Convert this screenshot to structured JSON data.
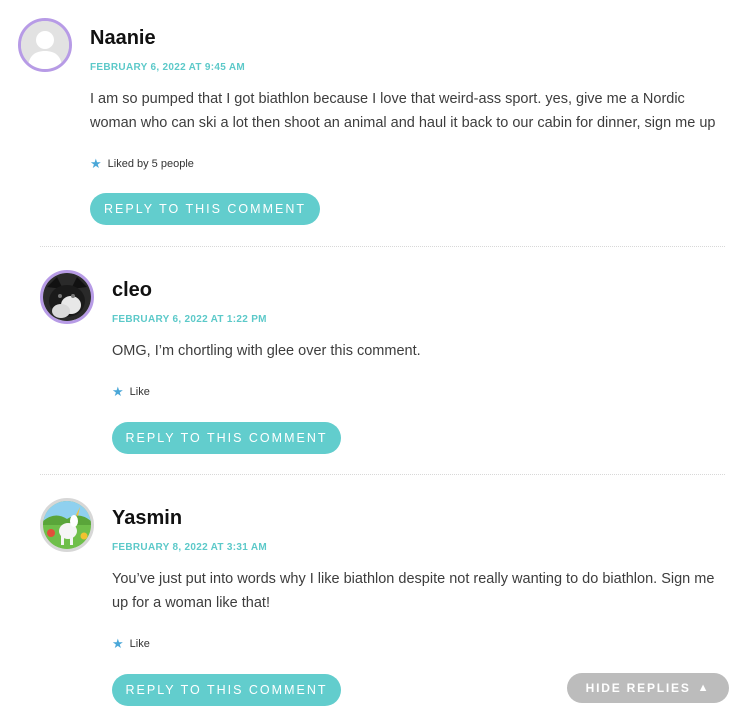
{
  "comments": [
    {
      "author": "Naanie",
      "date": "FEBRUARY 6, 2022 AT 9:45 AM",
      "text": "I am so pumped that I got biathlon because I love that weird-ass sport. yes, give me a Nordic woman who can ski a lot then shoot an animal and haul it back to our cabin for dinner, sign me up",
      "likes": "Liked by 5 people",
      "reply_label": "REPLY TO THIS COMMENT",
      "avatar_icon": "default-person-avatar"
    },
    {
      "author": "cleo",
      "date": "FEBRUARY 6, 2022 AT 1:22 PM",
      "text": "OMG, I’m chortling with glee over this comment.",
      "likes": "Like",
      "reply_label": "REPLY TO THIS COMMENT",
      "avatar_icon": "cat-photo-avatar"
    },
    {
      "author": "Yasmin",
      "date": "FEBRUARY 8, 2022 AT 3:31 AM",
      "text": "You’ve just put into words why I like biathlon despite not really wanting to do biathlon. Sign me up for a woman like that!",
      "likes": "Like",
      "reply_label": "REPLY TO THIS COMMENT",
      "avatar_icon": "unicorn-picture-avatar"
    }
  ],
  "hide_replies": {
    "label": "HIDE REPLIES",
    "icon": "triangle-up-icon"
  },
  "colors": {
    "accent": "#62cdcd",
    "date": "#5cc9c9",
    "avatar_border": "#b79be6",
    "star": "#4aa7d8",
    "hide_button": "#bcbcbc"
  }
}
